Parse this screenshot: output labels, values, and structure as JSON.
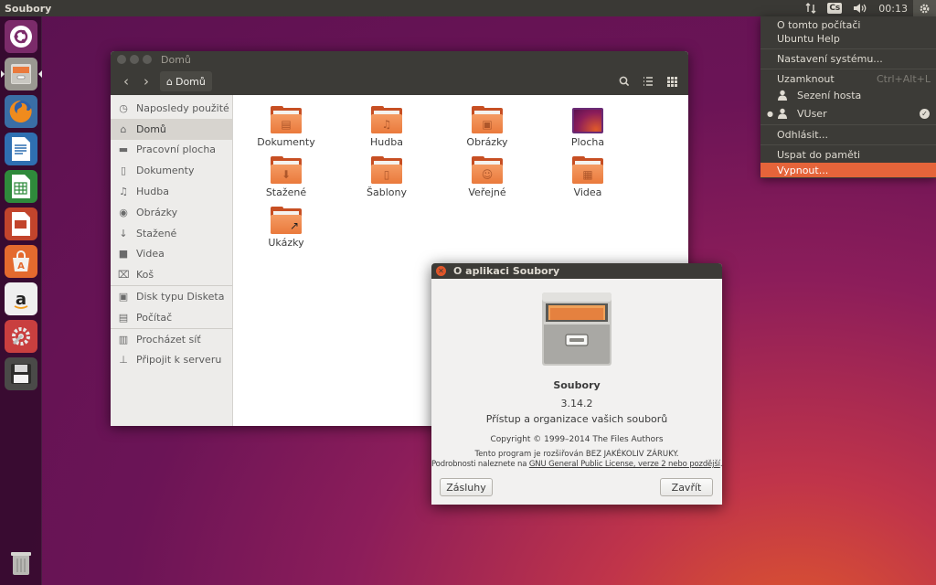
{
  "top_panel": {
    "app_title": "Soubory",
    "keyboard_layout": "Cs",
    "clock": "00:13"
  },
  "launcher": {
    "items": [
      "dash-ubuntu",
      "files",
      "firefox",
      "libreoffice-writer",
      "libreoffice-calc",
      "libreoffice-impress",
      "ubuntu-software-center",
      "amazon",
      "system-settings",
      "save-floppy",
      "trash"
    ]
  },
  "files_window": {
    "title": "Domů",
    "path_button": "Domů",
    "sidebar": {
      "group1": [
        {
          "label": "Naposledy použité",
          "icon": "clock-icon"
        },
        {
          "label": "Domů",
          "icon": "home-icon",
          "active": true
        },
        {
          "label": "Pracovní plocha",
          "icon": "folder-icon"
        },
        {
          "label": "Dokumenty",
          "icon": "document-icon"
        },
        {
          "label": "Hudba",
          "icon": "music-icon"
        },
        {
          "label": "Obrázky",
          "icon": "camera-icon"
        },
        {
          "label": "Stažené",
          "icon": "download-icon"
        },
        {
          "label": "Videa",
          "icon": "video-icon"
        },
        {
          "label": "Koš",
          "icon": "trash-icon"
        }
      ],
      "group2": [
        {
          "label": "Disk typu Disketa",
          "icon": "floppy-icon"
        },
        {
          "label": "Počítač",
          "icon": "computer-icon"
        }
      ],
      "group3": [
        {
          "label": "Procházet síť",
          "icon": "network-icon"
        },
        {
          "label": "Připojit k serveru",
          "icon": "server-icon"
        }
      ]
    },
    "folders": [
      {
        "label": "Dokumenty",
        "emblem": "document"
      },
      {
        "label": "Hudba",
        "emblem": "music"
      },
      {
        "label": "Obrázky",
        "emblem": "pictures"
      },
      {
        "label": "Plocha",
        "emblem": "desktop"
      },
      {
        "label": "Stažené",
        "emblem": "download"
      },
      {
        "label": "Šablony",
        "emblem": "templates"
      },
      {
        "label": "Veřejné",
        "emblem": "public"
      },
      {
        "label": "Videa",
        "emblem": "video"
      },
      {
        "label": "Ukázky",
        "emblem": "link"
      }
    ]
  },
  "about_dialog": {
    "title": "O aplikaci Soubory",
    "app_name": "Soubory",
    "version": "3.14.2",
    "description": "Přístup a organizace vašich souborů",
    "copyright": "Copyright © 1999–2014 The Files Authors",
    "license_line1": "Tento program je rozšiřován BEZ JAKÉKOLIV ZÁRUKY.",
    "license_line2_prefix": "Podrobnosti naleznete na ",
    "license_link": "GNU General Public License, verze 2 nebo pozdější",
    "license_line2_suffix": ".",
    "credits_button": "Zásluhy",
    "close_button": "Zavřít"
  },
  "session_menu": {
    "items": {
      "about": "O tomto počítači",
      "help": "Ubuntu Help",
      "settings": "Nastavení systému...",
      "lock": "Uzamknout",
      "lock_shortcut": "Ctrl+Alt+L",
      "guest": "Sezení hosta",
      "user": "VUser",
      "logout": "Odhlásit...",
      "suspend": "Uspat do paměti",
      "shutdown": "Vypnout..."
    }
  },
  "colors": {
    "accent": "#e5643a",
    "panel": "#3a3935",
    "folder": "#ea7a3c"
  }
}
